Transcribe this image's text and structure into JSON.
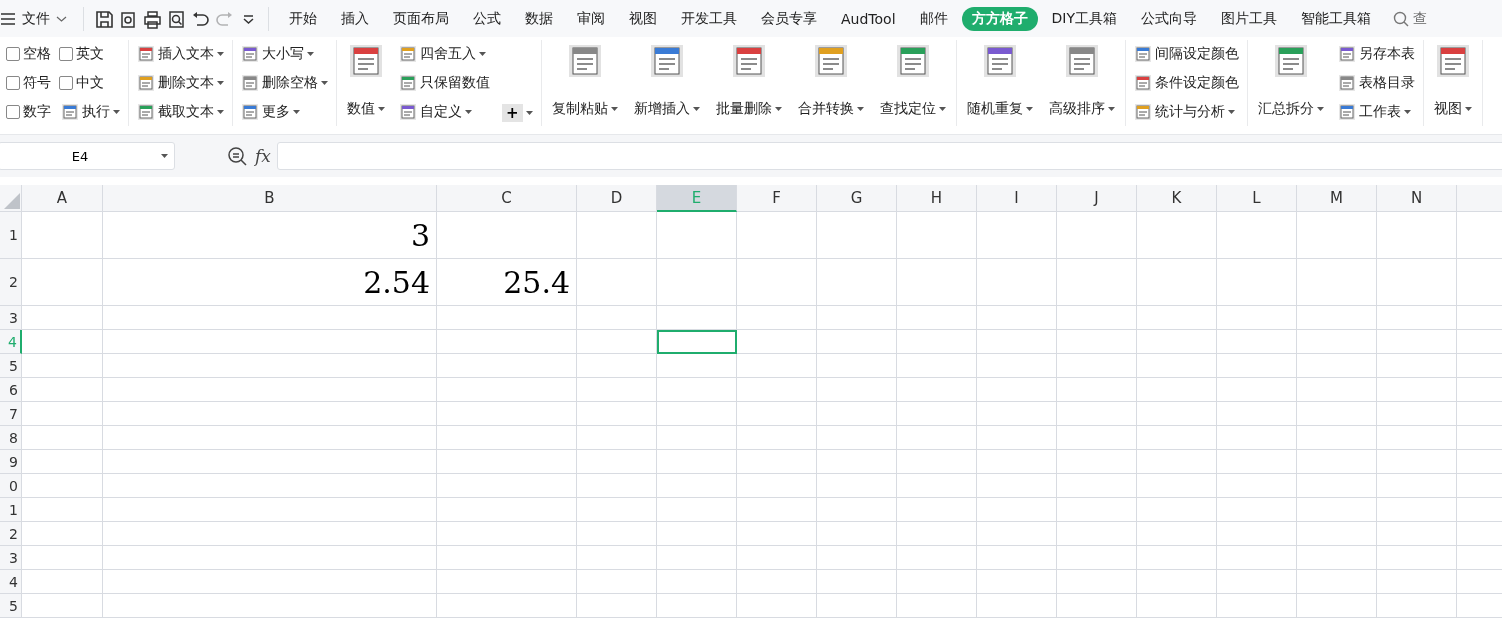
{
  "menubar": {
    "file_menu": "文件",
    "quick_actions": [
      {
        "kind": "save",
        "disabled": false
      },
      {
        "kind": "export",
        "disabled": false
      },
      {
        "kind": "print",
        "disabled": false
      },
      {
        "kind": "preview",
        "disabled": false
      },
      {
        "kind": "undo",
        "disabled": false
      },
      {
        "kind": "redo",
        "disabled": true
      },
      {
        "kind": "more",
        "disabled": false
      }
    ],
    "tabs": [
      {
        "label": "开始",
        "selected": false
      },
      {
        "label": "插入",
        "selected": false
      },
      {
        "label": "页面布局",
        "selected": false
      },
      {
        "label": "公式",
        "selected": false
      },
      {
        "label": "数据",
        "selected": false
      },
      {
        "label": "审阅",
        "selected": false
      },
      {
        "label": "视图",
        "selected": false
      },
      {
        "label": "开发工具",
        "selected": false
      },
      {
        "label": "会员专享",
        "selected": false
      },
      {
        "label": "AudTool",
        "selected": false
      },
      {
        "label": "邮件",
        "selected": false
      },
      {
        "label": "方方格子",
        "selected": true
      },
      {
        "label": "DIY工具箱",
        "selected": false
      },
      {
        "label": "公式向导",
        "selected": false
      },
      {
        "label": "图片工具",
        "selected": false
      },
      {
        "label": "智能工具箱",
        "selected": false
      }
    ],
    "search": "查"
  },
  "ribbon": {
    "groups": [
      {
        "columns": [
          {
            "kind": "stack",
            "items": [
              {
                "kind": "checkbox",
                "label": "空格",
                "checked": false
              },
              {
                "kind": "checkbox",
                "label": "符号",
                "checked": false
              },
              {
                "kind": "checkbox",
                "label": "数字",
                "checked": false
              }
            ]
          },
          {
            "kind": "stack",
            "items": [
              {
                "kind": "checkbox",
                "label": "英文",
                "checked": false
              },
              {
                "kind": "checkbox",
                "label": "中文",
                "checked": false
              },
              {
                "kind": "small",
                "label": "执行",
                "dropdown": true
              }
            ]
          }
        ]
      },
      {
        "columns": [
          {
            "kind": "stack",
            "items": [
              {
                "kind": "small",
                "label": "插入文本",
                "dropdown": true
              },
              {
                "kind": "small",
                "label": "删除文本",
                "dropdown": true
              },
              {
                "kind": "small",
                "label": "截取文本",
                "dropdown": true
              }
            ]
          }
        ]
      },
      {
        "columns": [
          {
            "kind": "stack",
            "items": [
              {
                "kind": "small",
                "label": "大小写",
                "dropdown": true
              },
              {
                "kind": "small",
                "label": "删除空格",
                "dropdown": true
              },
              {
                "kind": "small",
                "label": "更多",
                "dropdown": true
              }
            ]
          }
        ]
      },
      {
        "columns": [
          {
            "kind": "large",
            "label": "数值",
            "dropdown": true
          },
          {
            "kind": "stack",
            "items": [
              {
                "kind": "small",
                "label": "四舍五入",
                "dropdown": true
              },
              {
                "kind": "small",
                "label": "只保留数值",
                "dropdown": false
              },
              {
                "kind": "small",
                "label": "自定义",
                "dropdown": true
              }
            ]
          },
          {
            "kind": "stack",
            "items": [
              {
                "kind": "plain",
                "label": "+",
                "dropdown": true
              }
            ]
          }
        ]
      },
      {
        "columns": [
          {
            "kind": "large",
            "label": "复制粘贴",
            "dropdown": true
          },
          {
            "kind": "large",
            "label": "新增插入",
            "dropdown": true
          },
          {
            "kind": "large",
            "label": "批量删除",
            "dropdown": true
          },
          {
            "kind": "large",
            "label": "合并转换",
            "dropdown": true
          },
          {
            "kind": "large",
            "label": "查找定位",
            "dropdown": true
          }
        ]
      },
      {
        "columns": [
          {
            "kind": "large",
            "label": "随机重复",
            "dropdown": true
          },
          {
            "kind": "large",
            "label": "高级排序",
            "dropdown": true
          }
        ]
      },
      {
        "columns": [
          {
            "kind": "stack",
            "items": [
              {
                "kind": "small",
                "label": "间隔设定颜色",
                "dropdown": false
              },
              {
                "kind": "small",
                "label": "条件设定颜色",
                "dropdown": false
              },
              {
                "kind": "small",
                "label": "统计与分析",
                "dropdown": true
              }
            ]
          }
        ]
      },
      {
        "columns": [
          {
            "kind": "large",
            "label": "汇总拆分",
            "dropdown": true
          },
          {
            "kind": "stack",
            "items": [
              {
                "kind": "small",
                "label": "另存本表",
                "dropdown": false
              },
              {
                "kind": "small",
                "label": "表格目录",
                "dropdown": false
              },
              {
                "kind": "small",
                "label": "工作表",
                "dropdown": true
              }
            ]
          }
        ]
      },
      {
        "columns": [
          {
            "kind": "large",
            "label": "视图",
            "dropdown": true
          }
        ]
      }
    ]
  },
  "formula_bar": {
    "name_box": "E4",
    "fx": "fx"
  },
  "sheet": {
    "columns": [
      {
        "label": "A",
        "selected": false
      },
      {
        "label": "B",
        "selected": false
      },
      {
        "label": "C",
        "selected": false
      },
      {
        "label": "D",
        "selected": false
      },
      {
        "label": "E",
        "selected": true
      },
      {
        "label": "F",
        "selected": false
      },
      {
        "label": "G",
        "selected": false
      },
      {
        "label": "H",
        "selected": false
      },
      {
        "label": "I",
        "selected": false
      },
      {
        "label": "J",
        "selected": false
      },
      {
        "label": "K",
        "selected": false
      },
      {
        "label": "L",
        "selected": false
      },
      {
        "label": "M",
        "selected": false
      },
      {
        "label": "N",
        "selected": false
      }
    ],
    "rows": [
      {
        "header": "1",
        "selected": false,
        "cells": [
          null,
          "3"
        ]
      },
      {
        "header": "2",
        "selected": false,
        "cells": [
          null,
          "2.54",
          "25.4"
        ]
      },
      {
        "header": "3",
        "selected": false
      },
      {
        "header": "4",
        "selected": true
      },
      {
        "header": "5",
        "selected": false
      },
      {
        "header": "6",
        "selected": false
      },
      {
        "header": "7",
        "selected": false
      },
      {
        "header": "8",
        "selected": false
      },
      {
        "header": "9",
        "selected": false
      },
      {
        "header": "0",
        "selected": false
      },
      {
        "header": "1",
        "selected": false
      },
      {
        "header": "2",
        "selected": false
      },
      {
        "header": "3",
        "selected": false
      },
      {
        "header": "4",
        "selected": false
      },
      {
        "header": "5",
        "selected": false
      }
    ]
  }
}
